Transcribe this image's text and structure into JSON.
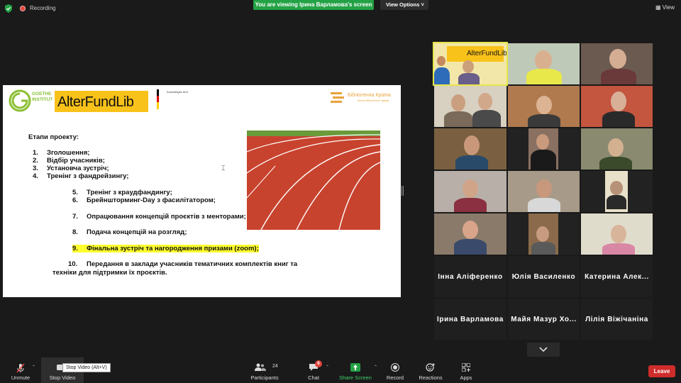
{
  "topbar": {
    "recording_label": "Recording",
    "viewing_banner": "You are viewing Ірина Варламова's screen",
    "view_options_label": "View Options ˅",
    "view_label": "View"
  },
  "slide": {
    "goethe_line1": "GOETHE",
    "goethe_line2": "INSTITUT",
    "alterfundlib": "AlterFundLib",
    "auswaertiges": "Auswärtiges Amt",
    "biblio_title": "Бібліотечна Країна",
    "biblio_sub": "Школа бібліотечних лідерів",
    "heading": "Етапи проекту:",
    "items": [
      {
        "n": "1.",
        "text": "Зголошення;"
      },
      {
        "n": "2.",
        "text": "Відбір учасників;"
      },
      {
        "n": "3.",
        "text": "Установча зустріч;"
      },
      {
        "n": "4.",
        "text": "Тренінг з фандрейзингу;"
      },
      {
        "n": "5.",
        "text": "Тренінг з краудфандингу;"
      },
      {
        "n": "6.",
        "text": "Брейншторминг-Day з фасилітатором;"
      },
      {
        "n": "7.",
        "text": "Опрацювання концепцій проєктів з менторами;"
      },
      {
        "n": "8.",
        "text": "Подача концепцій на розгляд;"
      },
      {
        "n": "9.",
        "text": "Фінальна зустріч та нагородження призами (zoom);"
      },
      {
        "n": "10.",
        "text": "Передання в заклади учасників тематичних комплектів книг та"
      }
    ],
    "item10_cont": "техніки для підтримки їх проєктів."
  },
  "gallery": {
    "thumb_alterfundlib": "AlterFundLib",
    "names": [
      "Інна Аліференко",
      "Юлія Василенко",
      "Катерина Алек...",
      "Ірина Варламова",
      "Майя Мазур Хо...",
      "Лілія Віжічаніна"
    ]
  },
  "toolbar": {
    "unmute": "Unmute",
    "stop_video": "Stop Video",
    "tooltip": "Stop Video (Alt+V)",
    "participants": "Participants",
    "participants_count": "24",
    "chat": "Chat",
    "chat_badge": "6",
    "share_screen": "Share Screen",
    "record": "Record",
    "reactions": "Reactions",
    "apps": "Apps",
    "leave": "Leave"
  },
  "colors": {
    "share_green": "#23a245",
    "leave_red": "#cf2c2c",
    "highlight_yellow": "#ffff2e",
    "afl_yellow": "#f9c21a"
  }
}
